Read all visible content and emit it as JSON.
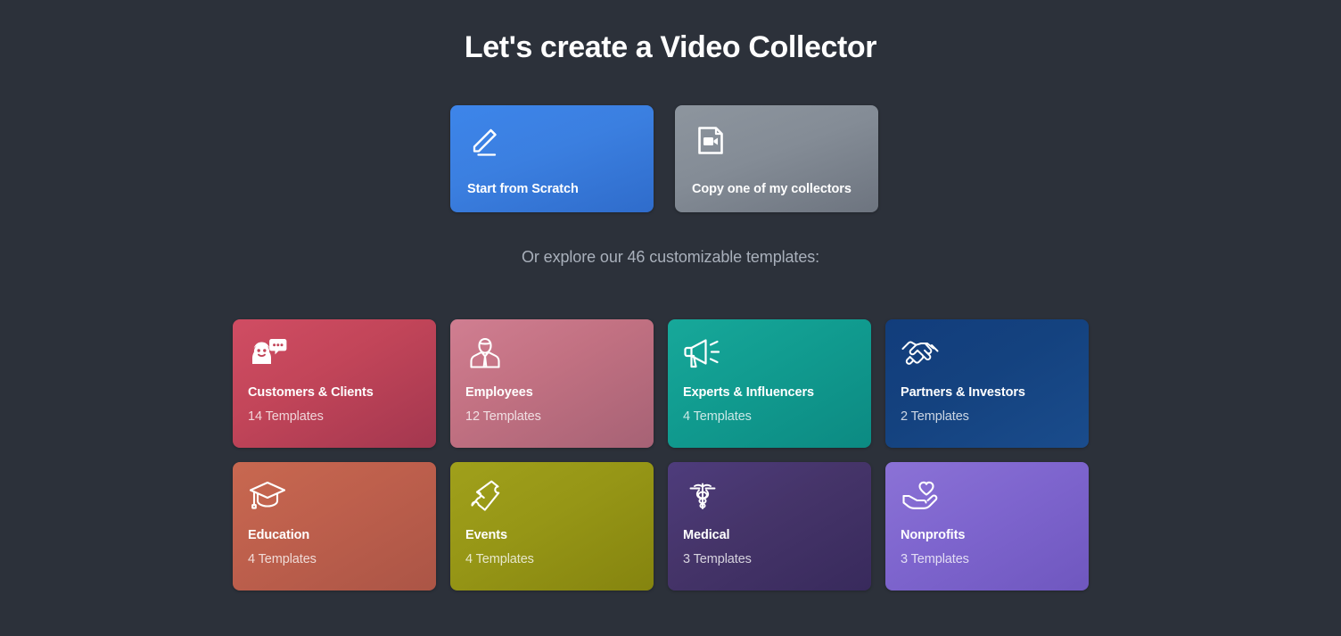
{
  "header": {
    "title": "Let's create a Video Collector"
  },
  "actions": [
    {
      "label": "Start from Scratch",
      "icon": "pencil-icon",
      "color": "#3b7fe0",
      "name": "start-from-scratch"
    },
    {
      "label": "Copy one of my collectors",
      "icon": "video-document-icon",
      "color": "#848c96",
      "name": "copy-my-collectors"
    }
  ],
  "subtitle": "Or explore our 46 customizable templates:",
  "template_total": 46,
  "templates": [
    {
      "title": "Customers & Clients",
      "count": "14 Templates",
      "count_value": 14,
      "icon": "customer-chat-icon",
      "color": "#ce4960",
      "color_end": "#a3374f",
      "name": "template-customers-clients"
    },
    {
      "title": "Employees",
      "count": "12 Templates",
      "count_value": 12,
      "icon": "employee-icon",
      "color": "#ce7a8e",
      "color_end": "#a66275",
      "name": "template-employees"
    },
    {
      "title": "Experts & Influencers",
      "count": "4 Templates",
      "count_value": 4,
      "icon": "megaphone-icon",
      "color": "#11a294",
      "color_end": "#0d8d85",
      "name": "template-experts-influencers"
    },
    {
      "title": "Partners & Investors",
      "count": "2 Templates",
      "count_value": 2,
      "icon": "handshake-icon",
      "color": "#133e7e",
      "color_end": "#16447f",
      "name": "template-partners-investors"
    },
    {
      "title": "Education",
      "count": "4 Templates",
      "count_value": 4,
      "icon": "graduation-cap-icon",
      "color": "#c2644e",
      "color_end": "#b25a48",
      "name": "template-education"
    },
    {
      "title": "Events",
      "count": "4 Templates",
      "count_value": 4,
      "icon": "ticket-icon",
      "color": "#9a9a18",
      "color_end": "#8d8c12",
      "name": "template-events"
    },
    {
      "title": "Medical",
      "count": "3 Templates",
      "count_value": 3,
      "icon": "caduceus-icon",
      "color": "#4c3a78",
      "color_end": "#3f3068",
      "name": "template-medical"
    },
    {
      "title": "Nonprofits",
      "count": "3 Templates",
      "count_value": 3,
      "icon": "heart-hand-icon",
      "color": "#7e65ce",
      "color_end": "#7358c4",
      "name": "template-nonprofits"
    }
  ],
  "theme": {
    "background": "#2c313a",
    "text_primary": "#ffffff",
    "text_secondary": "#a9b0bb"
  }
}
